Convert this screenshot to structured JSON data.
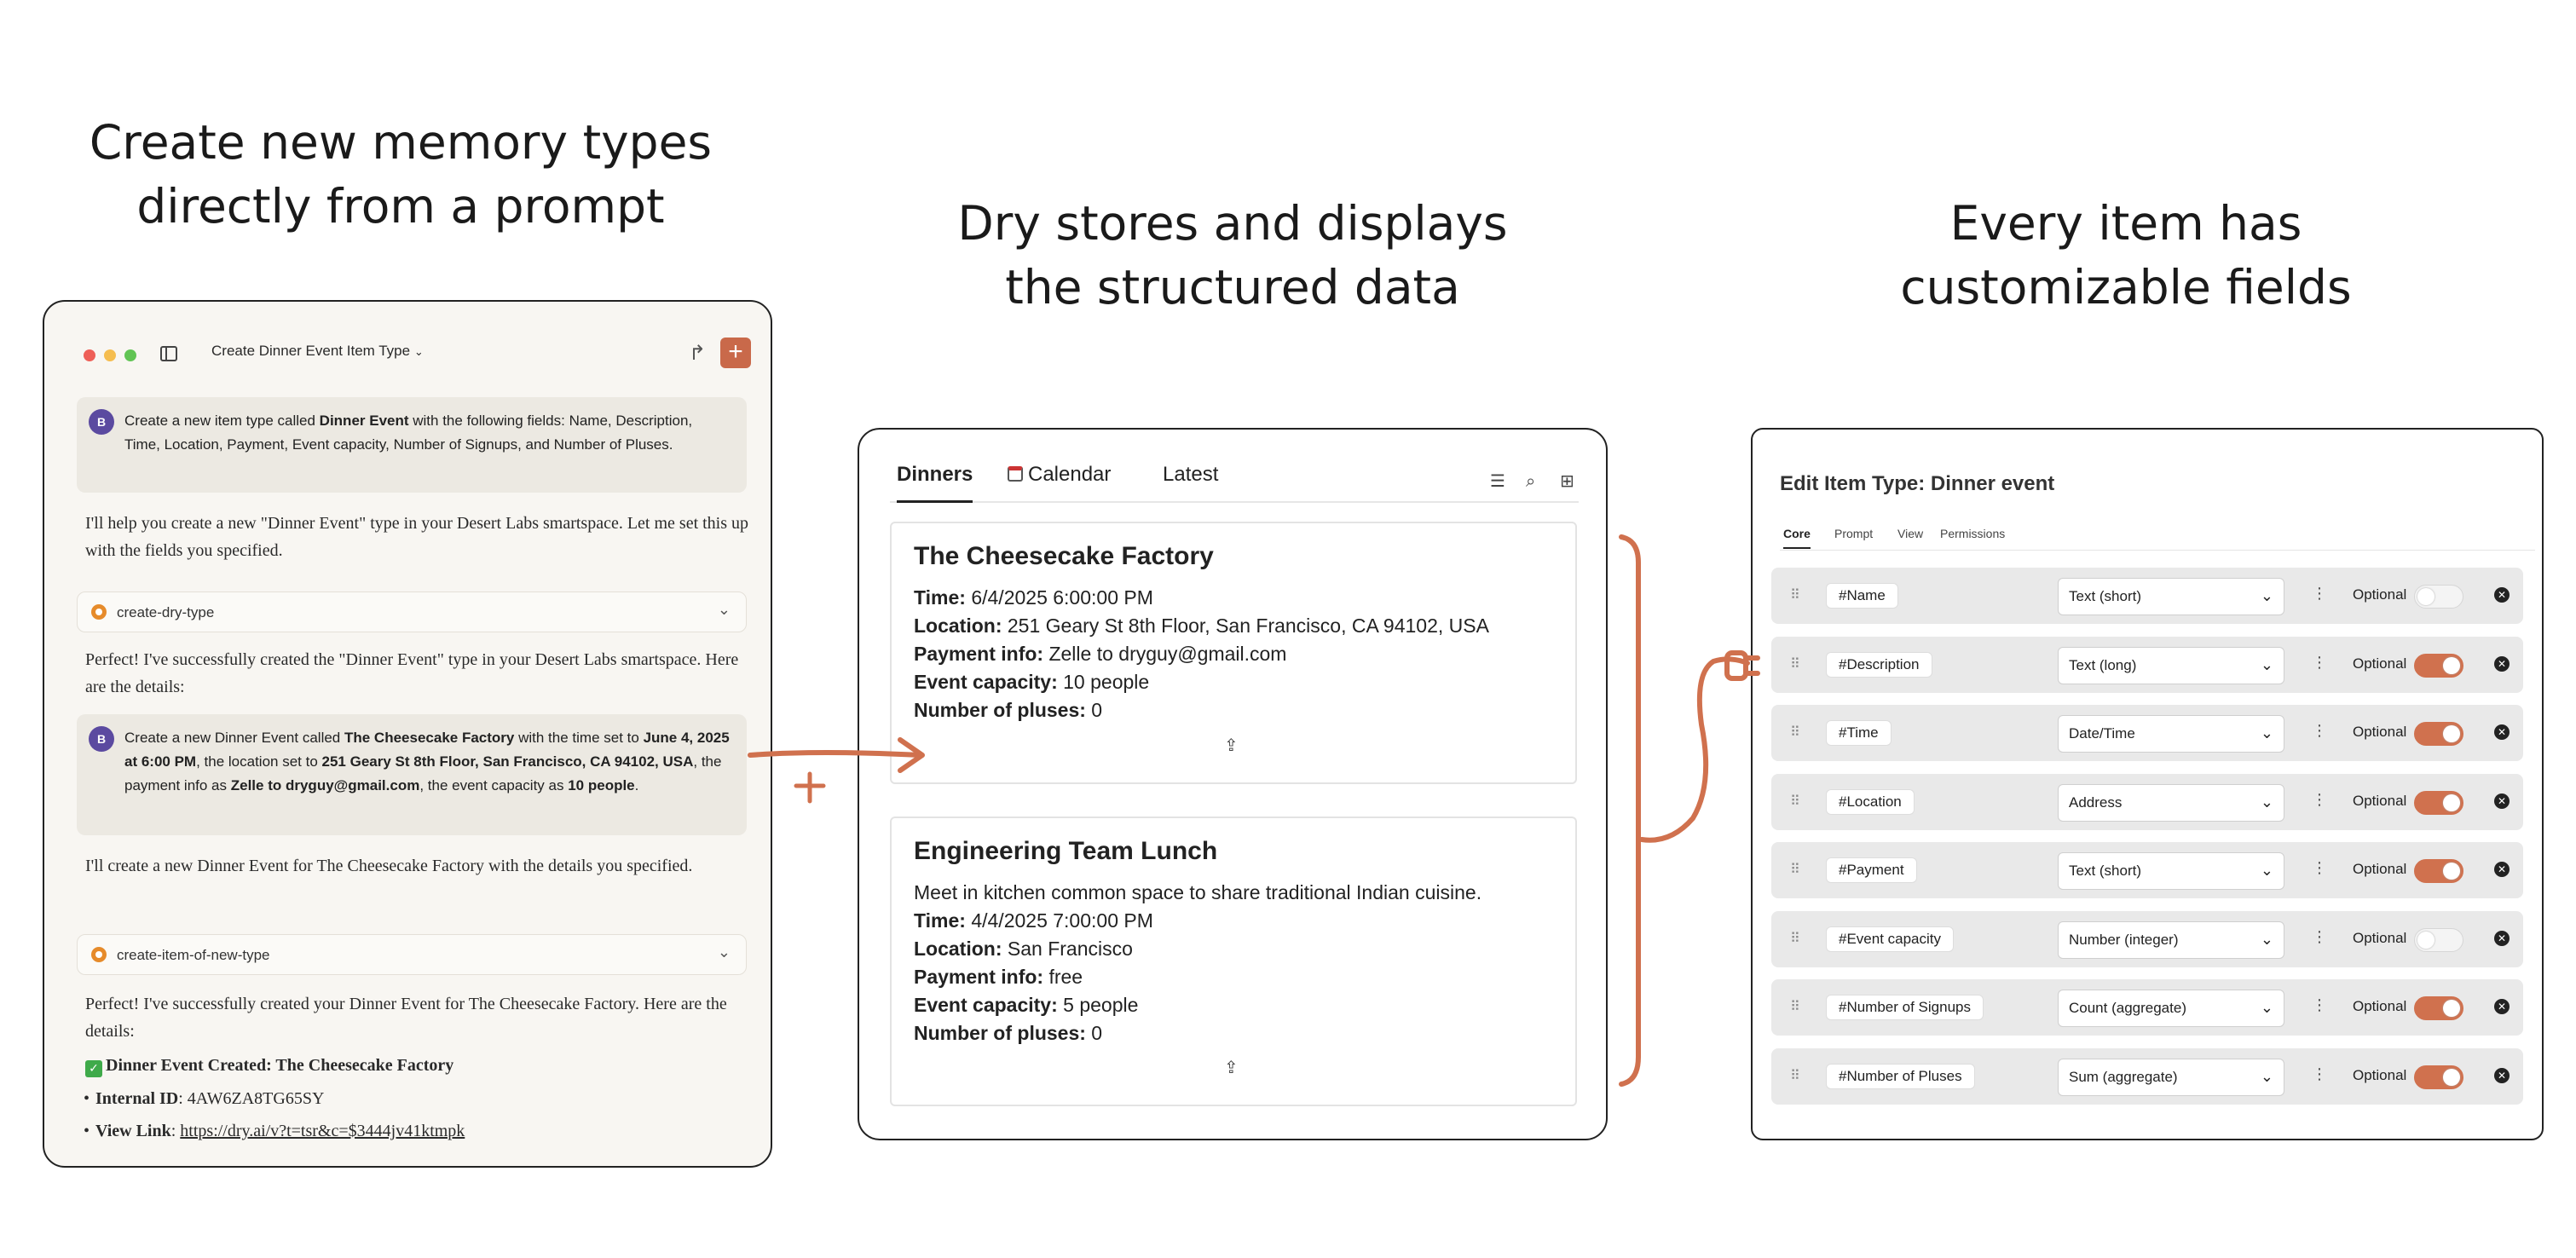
{
  "headings": {
    "left": [
      "Create new memory types",
      "directly from a prompt"
    ],
    "middle": [
      "Dry stores and displays",
      "the structured data"
    ],
    "right": [
      "Every item has",
      "customizable fields"
    ]
  },
  "chat": {
    "window_title": "Create Dinner Event Item Type",
    "user1": {
      "avatar": "B",
      "pre": "Create a new item type called ",
      "bold": "Dinner Event",
      "post": " with the following fields: Name, Description, Time, Location, Payment, Event capacity, Number of Signups, and Number of Pluses."
    },
    "ai1": "I'll help you create a new \"Dinner Event\" type in your Desert Labs smartspace. Let me set this up with the fields you specified.",
    "tool1": "create-dry-type",
    "ai2": "Perfect! I've successfully created the \"Dinner Event\" type in your Desert Labs smartspace. Here are the details:",
    "user2": {
      "avatar": "B",
      "t1": "Create a new Dinner Event called ",
      "b1": "The Cheesecake Factory",
      "t2": " with the time set to ",
      "b2": "June 4, 2025 at 6:00 PM",
      "t3": ", the location set to ",
      "b3": "251 Geary St 8th Floor, San Francisco, CA 94102, USA",
      "t4": ", the payment info as ",
      "b4": "Zelle to dryguy@gmail.com",
      "t5": ", the event capacity as ",
      "b5": "10 people",
      "t6": "."
    },
    "ai3": "I'll create a new Dinner Event for The Cheesecake Factory with the details you specified.",
    "tool2": "create-item-of-new-type",
    "ai4": "Perfect! I've successfully created your Dinner Event for The Cheesecake Factory. Here are the details:",
    "created_heading": "Dinner Event Created: The Cheesecake Factory",
    "bullets": [
      {
        "label": "Internal ID",
        "value": ": 4AW6ZA8TG65SY"
      },
      {
        "label": "View Link",
        "value": "https://dry.ai/v?t=tsr&c=$3444jv41ktmpk"
      }
    ]
  },
  "dinners": {
    "tabs": [
      "Dinners",
      "Calendar",
      "Latest"
    ],
    "cards": [
      {
        "title": "The Cheesecake Factory",
        "lines": [
          {
            "label": "Time:",
            "value": " 6/4/2025 6:00:00 PM"
          },
          {
            "label": "Location:",
            "value": " 251 Geary St 8th Floor, San Francisco, CA 94102, USA"
          },
          {
            "label": "Payment info:",
            "value": " Zelle to dryguy@gmail.com"
          },
          {
            "label": "Event capacity:",
            "value": " 10 people"
          },
          {
            "label": "Number of pluses:",
            "value": " 0"
          }
        ]
      },
      {
        "title": "Engineering Team Lunch",
        "description": "Meet in kitchen common space to share traditional Indian cuisine.",
        "lines": [
          {
            "label": "Time:",
            "value": " 4/4/2025 7:00:00 PM"
          },
          {
            "label": "Location:",
            "value": " San Francisco"
          },
          {
            "label": "Payment info:",
            "value": " free"
          },
          {
            "label": "Event capacity:",
            "value": " 5 people"
          },
          {
            "label": "Number of pluses:",
            "value": " 0"
          }
        ]
      }
    ]
  },
  "edit": {
    "title": "Edit Item Type: Dinner event",
    "tabs": [
      "Core",
      "Prompt",
      "View",
      "Permissions"
    ],
    "optional_label": "Optional",
    "fields": [
      {
        "name": "#Name",
        "type": "Text (short)",
        "optional": false
      },
      {
        "name": "#Description",
        "type": "Text (long)",
        "optional": true
      },
      {
        "name": "#Time",
        "type": "Date/Time",
        "optional": true
      },
      {
        "name": "#Location",
        "type": "Address",
        "optional": true
      },
      {
        "name": "#Payment",
        "type": "Text (short)",
        "optional": true
      },
      {
        "name": "#Event capacity",
        "type": "Number (integer)",
        "optional": false
      },
      {
        "name": "#Number of Signups",
        "type": "Count (aggregate)",
        "optional": true
      },
      {
        "name": "#Number of Pluses",
        "type": "Sum (aggregate)",
        "optional": true
      }
    ]
  },
  "colors": {
    "accent": "#c9694a",
    "toggle_on": "#d0714e",
    "avatar": "#5b4aa0"
  }
}
